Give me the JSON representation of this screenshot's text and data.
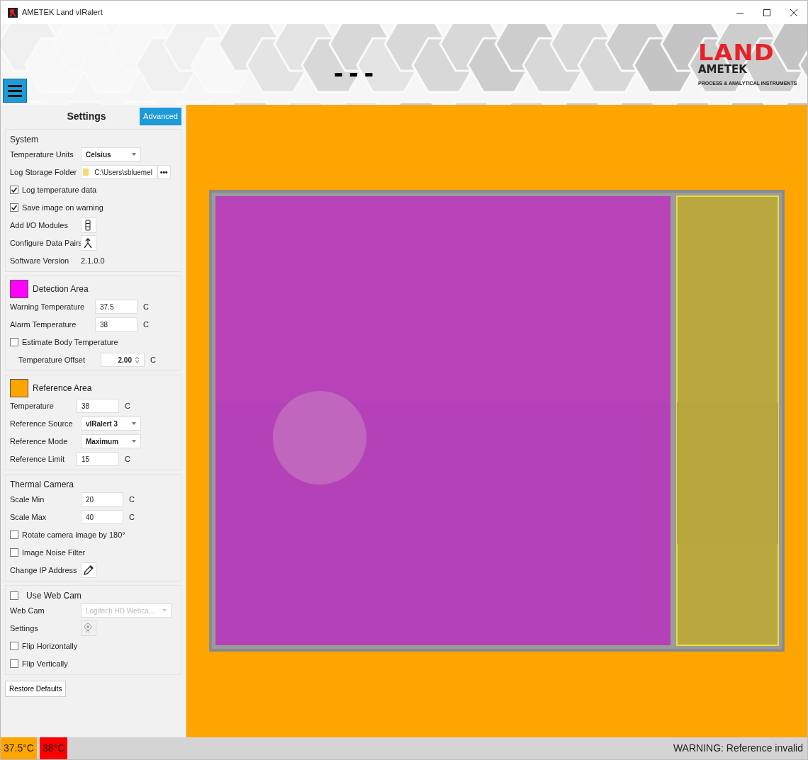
{
  "window": {
    "title": "AMETEK Land vIRalert"
  },
  "header": {
    "reading": "---",
    "logo": {
      "brand": "LAND",
      "company": "AMETEK",
      "tagline": "PROCESS & ANALYTICAL INSTRUMENTS"
    }
  },
  "settings": {
    "title": "Settings",
    "advanced_button": "Advanced",
    "sections": [
      {
        "title": "System",
        "rows": [
          {
            "kind": "select",
            "label": "Temperature Units",
            "value": "Celsius",
            "disabled": false
          },
          {
            "kind": "folder",
            "label": "Log Storage Folder",
            "value": "C:\\Users\\sbluemel",
            "button": "•••"
          },
          {
            "kind": "checkbox",
            "label": "Log temperature data",
            "checked": true
          },
          {
            "kind": "checkbox",
            "label": "Save image on warning",
            "checked": true
          },
          {
            "kind": "modules",
            "label": "Add I/O Modules",
            "disabled": false
          },
          {
            "kind": "pairs",
            "label": "Configure Data Pairs",
            "disabled": false
          },
          {
            "kind": "info",
            "label": "Software Version",
            "value": "2.1.0.0"
          }
        ]
      },
      {
        "title": "Detection Area",
        "color": "#ff00ff",
        "rows": [
          {
            "kind": "input",
            "label": "Warning Temperature",
            "value": "37.5",
            "unit": "C"
          },
          {
            "kind": "input",
            "label": "Alarm Temperature",
            "value": "38",
            "unit": "C"
          },
          {
            "kind": "checkbox",
            "label": "Estimate Body Temperature",
            "checked": false
          },
          {
            "kind": "spinner",
            "label": "Temperature Offset",
            "value": "2.00",
            "unit": "C"
          }
        ]
      },
      {
        "title": "Reference Area",
        "color": "#ffa500",
        "rows": [
          {
            "kind": "input",
            "label": "Temperature",
            "value": "38",
            "unit": "C"
          },
          {
            "kind": "select",
            "label": "Reference Source",
            "value": "vIRalert 3",
            "disabled": false
          },
          {
            "kind": "select",
            "label": "Reference Mode",
            "value": "Maximum",
            "disabled": false
          },
          {
            "kind": "input",
            "label": "Reference Limit",
            "value": "15",
            "unit": "C"
          }
        ]
      },
      {
        "title": "Thermal Camera",
        "rows": [
          {
            "kind": "input",
            "label": "Scale Min",
            "value": "20",
            "unit": "C"
          },
          {
            "kind": "input",
            "label": "Scale Max",
            "value": "40",
            "unit": "C"
          },
          {
            "kind": "checkbox",
            "label": "Rotate camera image by 180°",
            "checked": false
          },
          {
            "kind": "checkbox",
            "label": "Image Noise Filter",
            "checked": false
          },
          {
            "kind": "pencil",
            "label": "Change IP Address",
            "disabled": false
          }
        ]
      },
      {
        "title": "Use Web Cam",
        "checked": false,
        "rows": [
          {
            "kind": "select",
            "label": "Web Cam",
            "value": "Logitech HD Webca...",
            "disabled": true
          },
          {
            "kind": "webcam",
            "label": "Settings",
            "disabled": true
          },
          {
            "kind": "checkbox",
            "label": "Flip Horizontally",
            "checked": false
          },
          {
            "kind": "checkbox",
            "label": "Flip Vertically",
            "checked": false
          }
        ]
      }
    ],
    "restore_button": "Restore Defaults"
  },
  "status_bar": {
    "badges": [
      {
        "text": "37.5°C",
        "color": "#ffa500"
      },
      {
        "text": "38°C",
        "color": "#ff0000"
      }
    ],
    "message": "WARNING: Reference invalid"
  }
}
